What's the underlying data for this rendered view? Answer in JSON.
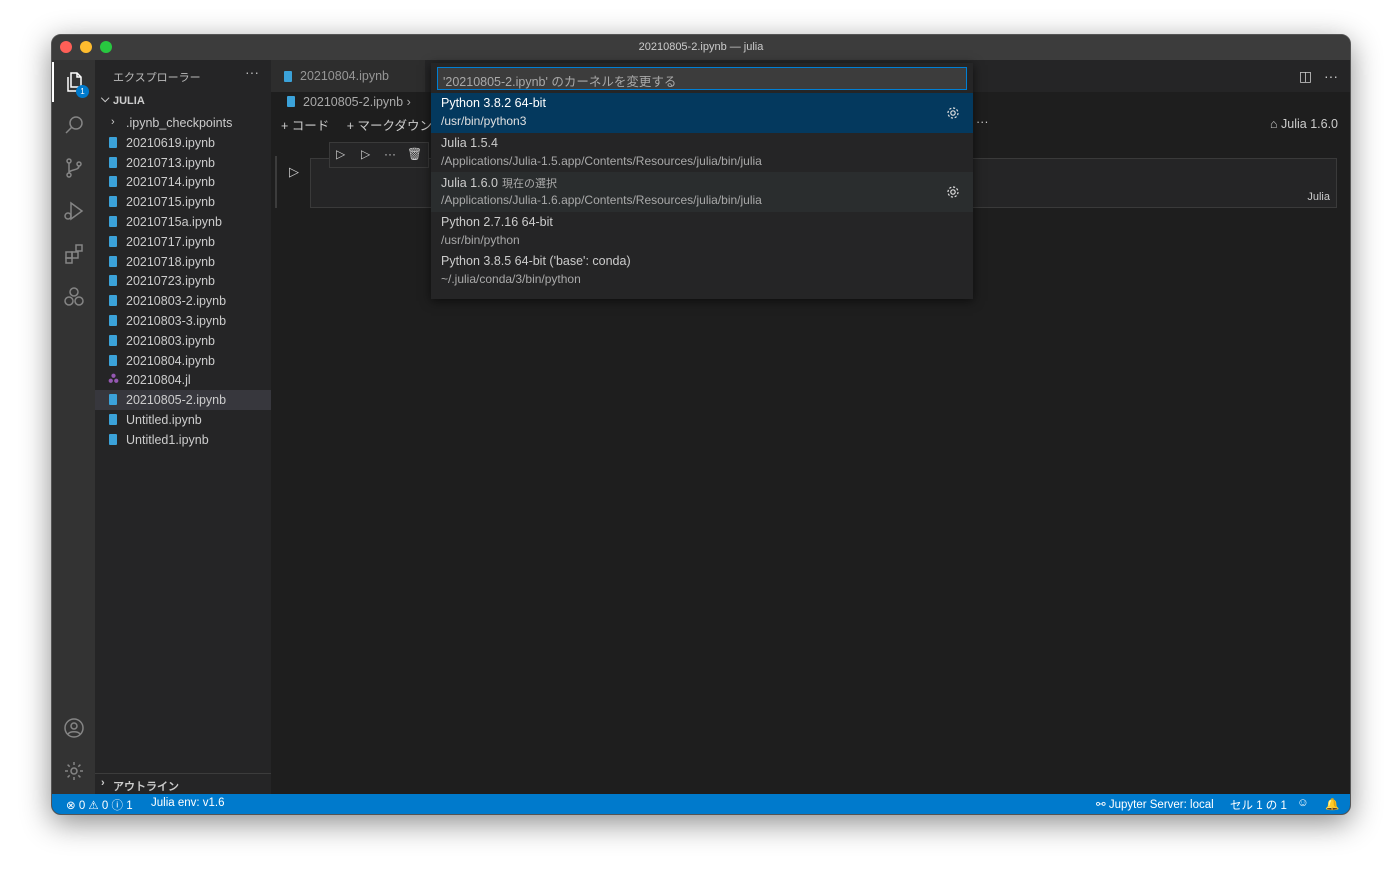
{
  "window": {
    "title": "20210805-2.ipynb — julia"
  },
  "activity_bar": {
    "explorer_badge": "1"
  },
  "sidebar": {
    "title": "エクスプローラー",
    "more": "···",
    "folder": "JULIA",
    "items": [
      {
        "label": ".ipynb_checkpoints",
        "type": "folder"
      },
      {
        "label": "20210619.ipynb",
        "type": "notebook"
      },
      {
        "label": "20210713.ipynb",
        "type": "notebook"
      },
      {
        "label": "20210714.ipynb",
        "type": "notebook"
      },
      {
        "label": "20210715.ipynb",
        "type": "notebook"
      },
      {
        "label": "20210715a.ipynb",
        "type": "notebook"
      },
      {
        "label": "20210717.ipynb",
        "type": "notebook"
      },
      {
        "label": "20210718.ipynb",
        "type": "notebook"
      },
      {
        "label": "20210723.ipynb",
        "type": "notebook"
      },
      {
        "label": "20210803-2.ipynb",
        "type": "notebook"
      },
      {
        "label": "20210803-3.ipynb",
        "type": "notebook"
      },
      {
        "label": "20210803.ipynb",
        "type": "notebook"
      },
      {
        "label": "20210804.ipynb",
        "type": "notebook"
      },
      {
        "label": "20210804.jl",
        "type": "julia"
      },
      {
        "label": "20210805-2.ipynb",
        "type": "notebook",
        "selected": true
      },
      {
        "label": "Untitled.ipynb",
        "type": "notebook"
      },
      {
        "label": "Untitled1.ipynb",
        "type": "notebook"
      }
    ],
    "outline": "アウトライン"
  },
  "editor": {
    "tabs": [
      {
        "label": "20210804.ipynb"
      }
    ],
    "breadcrumb": "20210805-2.ipynb",
    "toolbar": {
      "add_code": "+ コード",
      "add_markdown": "+ マークダウン"
    },
    "kernel": "Julia 1.6.0",
    "cell_language": "Julia",
    "more": "···"
  },
  "quick_pick": {
    "placeholder": "'20210805-2.ipynb' のカーネルを変更する",
    "items": [
      {
        "label": "Python 3.8.2 64-bit",
        "description": "/usr/bin/python3",
        "active": true,
        "gear": true
      },
      {
        "label": "Julia 1.5.4",
        "description": "/Applications/Julia-1.5.app/Contents/Resources/julia/bin/julia"
      },
      {
        "label": "Julia 1.6.0",
        "current": "現在の選択",
        "description": "/Applications/Julia-1.6.app/Contents/Resources/julia/bin/julia",
        "hover": true,
        "gear": true
      },
      {
        "label": "Python 2.7.16 64-bit",
        "description": "/usr/bin/python"
      },
      {
        "label": "Python 3.8.5 64-bit ('base': conda)",
        "description": "~/.julia/conda/3/bin/python"
      }
    ]
  },
  "status_bar": {
    "problems": "⊗ 0 ⚠ 0 ⓘ 1",
    "env": "Julia env: v1.6",
    "jupyter": "Jupyter Server: local",
    "cell": "セル 1 の 1"
  },
  "colors": {
    "accent": "#007acc",
    "selection": "#04395e",
    "notebook_icon": "#3ba2d9"
  }
}
